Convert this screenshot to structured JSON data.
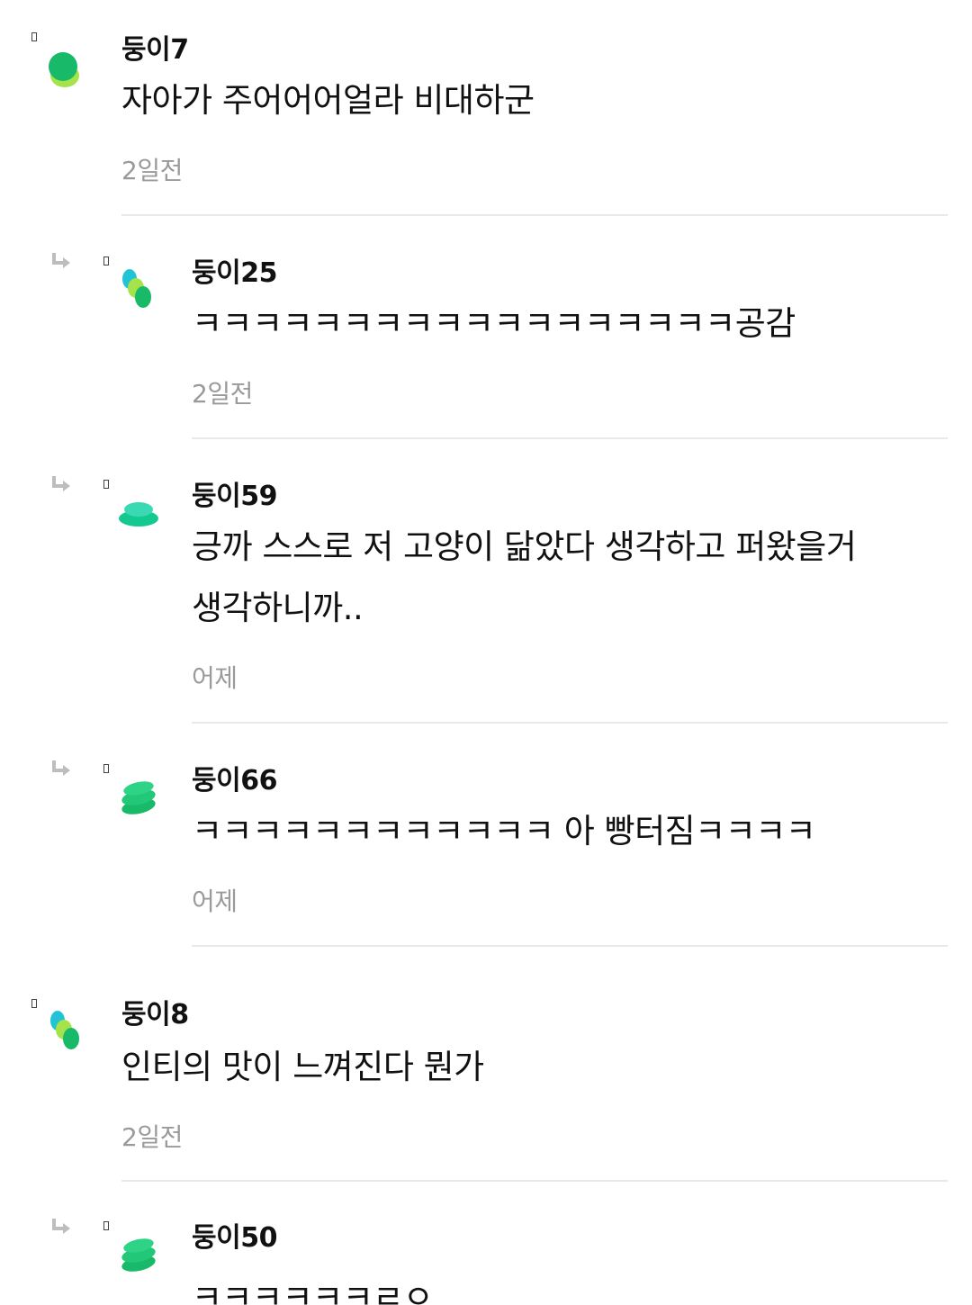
{
  "comments": [
    {
      "author": "둥이7",
      "text": "자아가 주어어어얼라 비대하군",
      "time": "2일전",
      "is_reply": false,
      "avatar": "green-blob-avatar"
    },
    {
      "author": "둥이25",
      "text": "ㅋㅋㅋㅋㅋㅋㅋㅋㅋㅋㅋㅋㅋㅋㅋㅋㅋㅋ공감",
      "time": "2일전",
      "is_reply": true,
      "avatar": "cyan-lime-green-dots-avatar"
    },
    {
      "author": "둥이59",
      "text": "긍까 스스로 저 고양이 닮았다 생각하고 퍼왔을거 생각하니까..",
      "time": "어제",
      "is_reply": true,
      "avatar": "teal-stack-avatar"
    },
    {
      "author": "둥이66",
      "text": "ㅋㅋㅋㅋㅋㅋㅋㅋㅋㅋㅋㅋ 아 빵터짐ㅋㅋㅋㅋ",
      "time": "어제",
      "is_reply": true,
      "avatar": "green-stack-avatar"
    },
    {
      "author": "둥이8",
      "text": "인티의 맛이 느껴진다 뭔가",
      "time": "2일전",
      "is_reply": false,
      "avatar": "cyan-lime-green-dots-avatar"
    },
    {
      "author": "둥이50",
      "text": "ㅋㅋㅋㅋㅋㅋㄹㅇ",
      "time": "",
      "is_reply": true,
      "avatar": "green-stack-avatar"
    }
  ],
  "colors": {
    "accent_green": "#18c26a",
    "lime": "#a6e34a",
    "cyan": "#22c3d6",
    "timestamp_gray": "#9a9a9a",
    "divider_gray": "#e9e9e9",
    "reply_arrow_gray": "#bdbdbd"
  }
}
